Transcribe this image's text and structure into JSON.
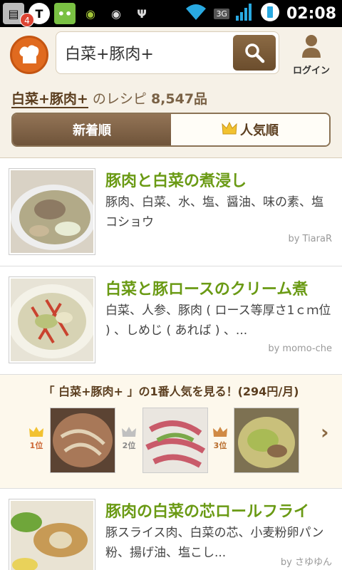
{
  "status_bar": {
    "notification_count": "4",
    "network": "3G",
    "time": "02:08"
  },
  "header": {
    "search_value": "白菜+豚肉+",
    "login_label": "ログイン"
  },
  "results": {
    "query": "白菜+豚肉+",
    "suffix": " のレシピ ",
    "count": "8,547品",
    "tabs": [
      {
        "label": "新着順",
        "active": true
      },
      {
        "label": "人気順",
        "active": false
      }
    ]
  },
  "recipes": [
    {
      "title": "豚肉と白菜の煮浸し",
      "ingredients": "豚肉、白菜、水、塩、醤油、味の素、塩コショウ",
      "author": "by TiaraR"
    },
    {
      "title": "白菜と豚ロースのクリーム煮",
      "ingredients": "白菜、人参、豚肉 ( ロース等厚さ1ｃｍ位 ) 、しめじ ( あれば ) 、...",
      "author": "by momo-che"
    },
    {
      "title": "豚肉の白菜の芯ロールフライ",
      "ingredients": "豚スライス肉、白菜の芯、小麦粉卵パン粉、揚げ油、塩こし...",
      "author": "by さゆゆん"
    }
  ],
  "ranking": {
    "title": "「 白菜+豚肉+ 」の1番人気を見る！(294円/月)",
    "badges": [
      "1位",
      "2位",
      "3位"
    ]
  },
  "colors": {
    "title_green": "#6a9a14",
    "brown": "#6f543a",
    "header_bg": "#f6f1e7"
  }
}
